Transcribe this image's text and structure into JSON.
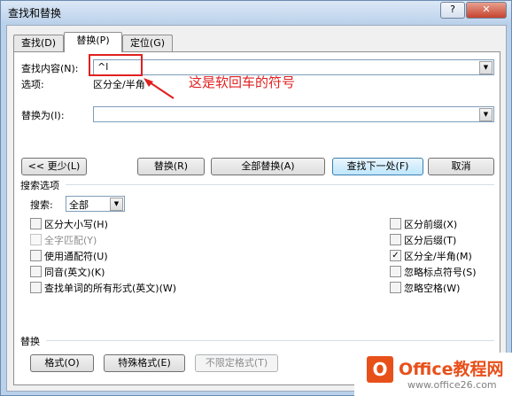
{
  "window": {
    "title": "查找和替换",
    "help_label": "?",
    "close_label": "✕"
  },
  "tabs": [
    {
      "label": "查找(D)"
    },
    {
      "label": "替换(P)"
    },
    {
      "label": "定位(G)"
    }
  ],
  "find": {
    "label": "查找内容(N):",
    "value": "^l"
  },
  "options": {
    "label": "选项:",
    "value": "区分全/半角"
  },
  "annotation": {
    "text": "这是软回车的符号",
    "color": "#e02020"
  },
  "replace": {
    "label": "替换为(I):",
    "value": ""
  },
  "buttons": {
    "less": "<< 更少(L)",
    "replace": "替换(R)",
    "replace_all": "全部替换(A)",
    "find_next": "查找下一处(F)",
    "cancel": "取消"
  },
  "search_options": {
    "header": "搜索选项",
    "search_label": "搜索:",
    "search_value": "全部"
  },
  "checkboxes_left": [
    {
      "label": "区分大小写(H)",
      "checked": false,
      "disabled": false
    },
    {
      "label": "全字匹配(Y)",
      "checked": false,
      "disabled": true
    },
    {
      "label": "使用通配符(U)",
      "checked": false,
      "disabled": false
    },
    {
      "label": "同音(英文)(K)",
      "checked": false,
      "disabled": false
    },
    {
      "label": "查找单词的所有形式(英文)(W)",
      "checked": false,
      "disabled": false
    }
  ],
  "checkboxes_right": [
    {
      "label": "区分前缀(X)",
      "checked": false
    },
    {
      "label": "区分后缀(T)",
      "checked": false
    },
    {
      "label": "区分全/半角(M)",
      "checked": true
    },
    {
      "label": "忽略标点符号(S)",
      "checked": false
    },
    {
      "label": "忽略空格(W)",
      "checked": false
    }
  ],
  "replace_section": {
    "header": "替换",
    "format_button": "格式(O)",
    "special_button": "特殊格式(E)",
    "no_format_button": "不限定格式(T)"
  },
  "watermark": {
    "brand": "Office教程网",
    "url": "www.office26.com"
  }
}
